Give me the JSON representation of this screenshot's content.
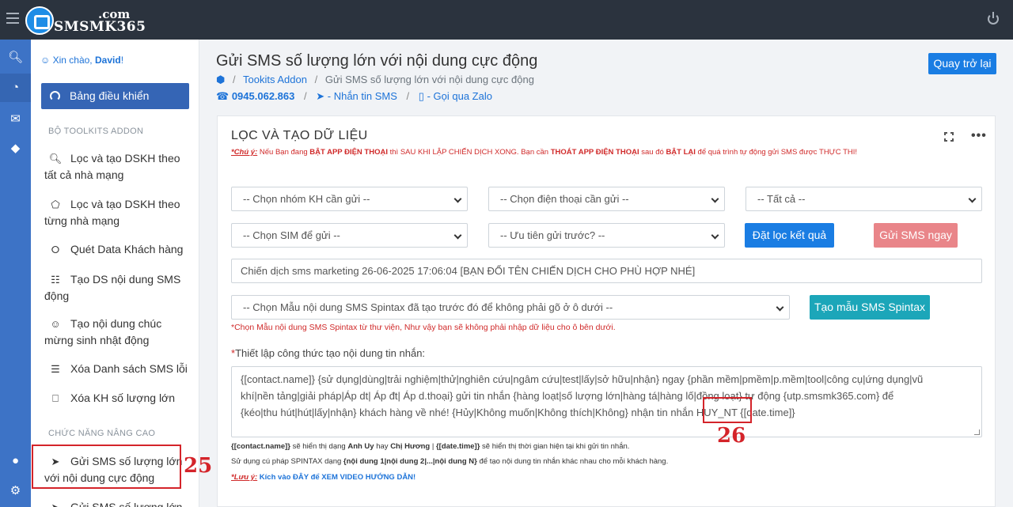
{
  "brand": {
    "com": ".com",
    "name": "SMSMK365"
  },
  "sidebar": {
    "greeting_prefix": "Xin chào,",
    "greeting_user": "David",
    "greeting_suffix": "!",
    "dashboard": "Bảng điều khiển",
    "section_toolkits": "BỘ TOOLKITS ADDON",
    "items": [
      {
        "label": "Lọc và tạo DSKH theo tất cả nhà mạng",
        "icon": "search-icon"
      },
      {
        "label": "Lọc và tạo DSKH theo từng nhà mạng",
        "icon": "tag-icon"
      },
      {
        "label": "Quét Data Khách hàng",
        "icon": "share-icon"
      },
      {
        "label": "Tạo DS nội dung SMS động",
        "icon": "comments-icon"
      },
      {
        "label": "Tạo nội dung chúc mừng sinh nhật động",
        "icon": "user-icon"
      },
      {
        "label": "Xóa Danh sách SMS lỗi",
        "icon": "list-icon"
      },
      {
        "label": "Xóa KH số lượng lớn",
        "icon": "trash-icon"
      }
    ],
    "section_advanced": "CHỨC NĂNG NÂNG CAO",
    "advanced_items": [
      {
        "label": "Gửi SMS số lượng lớn với nội dung cực động",
        "icon": "send-icon"
      },
      {
        "label": "Gửi SMS số lượng lớn",
        "icon": "send-icon"
      }
    ],
    "callout_25": "25"
  },
  "header": {
    "title": "Gửi SMS số lượng lớn với nội dung cực động",
    "breadcrumb": [
      "Tookits Addon",
      "Gửi SMS số lượng lớn với nội dung cực động"
    ],
    "phone": "0945.062.863",
    "sms_link": "- Nhắn tin SMS",
    "zalo_link": "- Gọi qua Zalo",
    "back_button": "Quay trở lại"
  },
  "card": {
    "title": "LỌC VÀ TẠO DỮ LIỆU",
    "note_label": "*Chú ý:",
    "note_1": " Nếu Bạn đang ",
    "note_b1": "BẬT APP ĐIỆN THOẠI",
    "note_2": " thì SAU KHI LẬP CHIẾN DỊCH XONG. Bạn cần ",
    "note_b2": "THOÁT APP ĐIỆN THOẠI",
    "note_3": " sau đó ",
    "note_b3": "BẬT LẠI",
    "note_4": " để quá trình tự động gửi SMS được THỰC THI!",
    "select_group": "-- Chọn nhóm KH cần gửi --",
    "select_phone": "-- Chọn điện thoại cần gửi --",
    "select_all": "-- Tất cả --",
    "select_sim": "-- Chọn SIM để gửi --",
    "select_priority": "-- Ưu tiên gửi trước? --",
    "filter_button": "Đặt lọc kết quả",
    "send_button": "Gửi SMS ngay",
    "campaign_value": "Chiến dịch sms marketing 26-06-2025 17:06:04 [BẠN ĐỔI TÊN CHIẾN DỊCH CHO PHÙ HỢP NHÉ]",
    "template_select": "-- Chọn Mẫu nội dung SMS Spintax đã tạo trước đó để không phải gõ ở ô dưới --",
    "template_button": "Tạo mẫu SMS Spintax",
    "template_hint": "*Chọn Mẫu nội dung SMS Spintax từ thư viện, Như vậy bạn sẽ không phải nhập dữ liệu cho ô bên dưới.",
    "formula_label": "Thiết lập công thức tạo nội dung tin nhắn:",
    "formula_line1": "{[contact.name]} {sử dụng|dùng|trải nghiệm|thử|nghiên cứu|ngâm cứu|test|lấy|sở hữu|nhận} ngay {phần mềm|pmềm|p.mềm|tool|công cụ|ứng dụng|vũ",
    "formula_line2": "khí|nền tảng|giải pháp|Áp dt| Áp đt| Áp d.thoại} gửi tin nhắn {hàng loạt|số lượng lớn|hàng tá|hàng lố|đồng loạt} tự động {utp.smsmk365.com} để",
    "formula_line3a": "{kéo|thu hút|hút|lấy|nhận} khách hàng về nhé! {Hủy|Không muốn|Không thích|Không} nhận tin nhắn ",
    "formula_sig": "HUY_NT",
    "formula_line3b": " {[date.time]}",
    "callout_26": "26",
    "help1_a": "{[contact.name]}",
    "help1_b": " sẽ hiển thị dạng ",
    "help1_c": "Anh Uy",
    "help1_d": " hay ",
    "help1_e": "Chị Hương",
    "help1_f": " | ",
    "help1_g": "{[date.time]}",
    "help1_h": " sẽ hiển thị thời gian hiện tại khi gửi tin nhắn.",
    "help2_a": "Sử dụng cú pháp SPINTAX dạng ",
    "help2_b": "{nội dung 1|nội dung 2|...|nội dung N}",
    "help2_c": " để tạo nội dung tin nhắn khác nhau cho mỗi khách hàng.",
    "help3_a": "*Lưu ý:",
    "help3_b": " Kích vào ĐÂY để XEM VIDEO HƯỚNG DẪN!"
  }
}
